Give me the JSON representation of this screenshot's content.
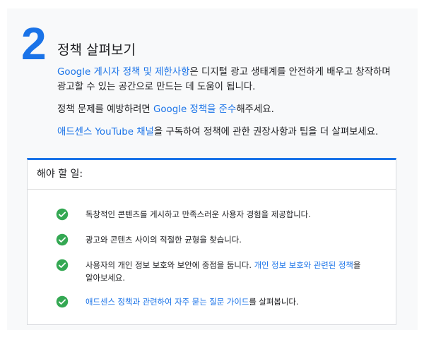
{
  "step": {
    "number": "2",
    "title": "정책 살펴보기"
  },
  "intro": {
    "p1_link": "Google 게시자 정책 및 제한사항",
    "p1_rest": "은 디지털 광고 생태계를 안전하게 배우고 창작하며 광고할 수 있는 공간으로 만드는 데 도움이 됩니다.",
    "p2_before": "정책 문제를 예방하려면 ",
    "p2_link": "Google 정책을 준수",
    "p2_after": "해주세요.",
    "p3_link": "애드센스 YouTube 채널",
    "p3_rest": "을 구독하여 정책에 관한 권장사항과 팁을 더 살펴보세요."
  },
  "todo": {
    "header": "해야 할 일:",
    "items": [
      {
        "text": "독창적인 콘텐츠를 게시하고 만족스러운 사용자 경험을 제공합니다.",
        "icon": "check-circle-icon"
      },
      {
        "text": "광고와 콘텐츠 사이의 적절한 균형을 찾습니다.",
        "icon": "check-circle-icon"
      },
      {
        "text_before": "사용자의 개인 정보 보호와 보안에 중점을 둡니다. ",
        "link": "개인 정보 보호와 관련된 정책",
        "text_after": "을 알아보세요.",
        "icon": "check-circle-icon"
      },
      {
        "link": "애드센스 정책과 관련하여 자주 묻는 질문 가이드",
        "text_after": "를 살펴봅니다.",
        "icon": "check-circle-icon"
      }
    ]
  },
  "colors": {
    "accent": "#1a73e8",
    "check": "#34a853",
    "panel_bg": "#f8f9fa"
  }
}
